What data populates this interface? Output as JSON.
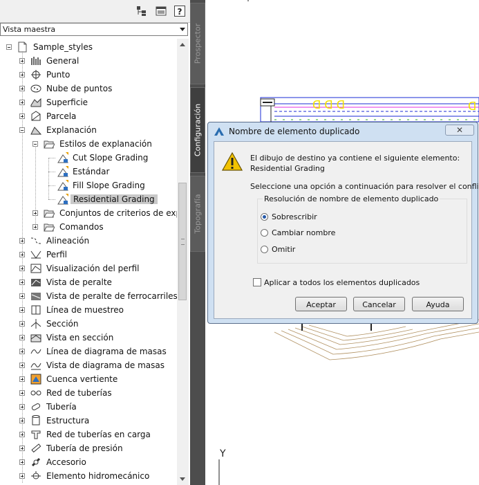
{
  "toolspace": {
    "view_selector": "Vista maestra",
    "toolbar_icons": [
      "tree-view-icon",
      "panel-icon",
      "help-icon"
    ],
    "help_glyph": "?",
    "tree": [
      {
        "label": "Sample_styles",
        "level": 0,
        "icon": "drawing-icon",
        "expander": "minus"
      },
      {
        "label": "General",
        "level": 1,
        "icon": "general-icon",
        "expander": "plus"
      },
      {
        "label": "Punto",
        "level": 1,
        "icon": "point-icon",
        "expander": "plus"
      },
      {
        "label": "Nube de puntos",
        "level": 1,
        "icon": "point-cloud-icon",
        "expander": "plus"
      },
      {
        "label": "Superficie",
        "level": 1,
        "icon": "surface-icon",
        "expander": "plus"
      },
      {
        "label": "Parcela",
        "level": 1,
        "icon": "parcel-icon",
        "expander": "plus"
      },
      {
        "label": "Explanación",
        "level": 1,
        "icon": "grading-icon",
        "expander": "minus"
      },
      {
        "label": "Estilos de explanación",
        "level": 2,
        "icon": "folder-open-icon",
        "expander": "minus"
      },
      {
        "label": "Cut Slope Grading",
        "level": 3,
        "icon": "grading-style-icon",
        "expander": "none"
      },
      {
        "label": "Estándar",
        "level": 3,
        "icon": "grading-style-icon",
        "expander": "none"
      },
      {
        "label": "Fill Slope Grading",
        "level": 3,
        "icon": "grading-style-icon",
        "expander": "none"
      },
      {
        "label": "Residential Grading",
        "level": 3,
        "icon": "grading-style-icon",
        "expander": "none",
        "selected": true
      },
      {
        "label": "Conjuntos de criterios de expl...",
        "level": 2,
        "icon": "folder-open-icon",
        "expander": "plus"
      },
      {
        "label": "Comandos",
        "level": 2,
        "icon": "folder-open-icon",
        "expander": "plus"
      },
      {
        "label": "Alineación",
        "level": 1,
        "icon": "alignment-icon",
        "expander": "plus"
      },
      {
        "label": "Perfil",
        "level": 1,
        "icon": "profile-icon",
        "expander": "plus"
      },
      {
        "label": "Visualización del perfil",
        "level": 1,
        "icon": "profile-view-icon",
        "expander": "plus"
      },
      {
        "label": "Vista de peralte",
        "level": 1,
        "icon": "superelevation-view-icon",
        "expander": "plus"
      },
      {
        "label": "Vista de peralte de ferrocarriles",
        "level": 1,
        "icon": "rail-superelevation-icon",
        "expander": "plus"
      },
      {
        "label": "Línea de muestreo",
        "level": 1,
        "icon": "sample-line-icon",
        "expander": "plus"
      },
      {
        "label": "Sección",
        "level": 1,
        "icon": "section-icon",
        "expander": "plus"
      },
      {
        "label": "Vista en sección",
        "level": 1,
        "icon": "section-view-icon",
        "expander": "plus"
      },
      {
        "label": "Línea de diagrama de masas",
        "level": 1,
        "icon": "mass-haul-line-icon",
        "expander": "plus"
      },
      {
        "label": "Vista de diagrama de masas",
        "level": 1,
        "icon": "mass-haul-view-icon",
        "expander": "plus"
      },
      {
        "label": "Cuenca vertiente",
        "level": 1,
        "icon": "catchment-icon",
        "expander": "plus"
      },
      {
        "label": "Red de tuberías",
        "level": 1,
        "icon": "pipe-network-icon",
        "expander": "plus"
      },
      {
        "label": "Tubería",
        "level": 1,
        "icon": "pipe-icon",
        "expander": "plus"
      },
      {
        "label": "Estructura",
        "level": 1,
        "icon": "structure-icon",
        "expander": "plus"
      },
      {
        "label": "Red de tuberías en carga",
        "level": 1,
        "icon": "pressure-network-icon",
        "expander": "plus"
      },
      {
        "label": "Tubería de presión",
        "level": 1,
        "icon": "pressure-pipe-icon",
        "expander": "plus"
      },
      {
        "label": "Accesorio",
        "level": 1,
        "icon": "fitting-icon",
        "expander": "plus"
      },
      {
        "label": "Elemento hidromecánico",
        "level": 1,
        "icon": "appurtenance-icon",
        "expander": "plus"
      }
    ]
  },
  "side_tabs": [
    {
      "label": "Prospector",
      "active": false
    },
    {
      "label": "Configuración",
      "active": true
    },
    {
      "label": "Topografía",
      "active": false
    }
  ],
  "drawing": {
    "axis_label": "Y"
  },
  "dialog": {
    "title": "Nombre de elemento duplicado",
    "close_glyph": "✕",
    "message_line1": "El dibujo de destino ya contiene el siguiente elemento:",
    "message_line2": "Residential Grading",
    "instruction": "Seleccione una opción a continuación para resolver el conflicto.",
    "group_label": "Resolución de nombre de elemento duplicado",
    "options": [
      {
        "label": "Sobrescribir",
        "checked": true
      },
      {
        "label": "Cambiar nombre",
        "checked": false
      },
      {
        "label": "Omitir",
        "checked": false
      }
    ],
    "apply_all_label": "Aplicar a todos los elementos duplicados",
    "apply_all_checked": false,
    "buttons": {
      "ok": "Aceptar",
      "cancel": "Cancelar",
      "help": "Ayuda"
    },
    "icon": "warning-icon"
  },
  "colors": {
    "selection": "#c9c9c9",
    "tab_bar": "#4d4d4d",
    "dialog_frame": "#cfe0f2",
    "warning": "#f2c200"
  }
}
